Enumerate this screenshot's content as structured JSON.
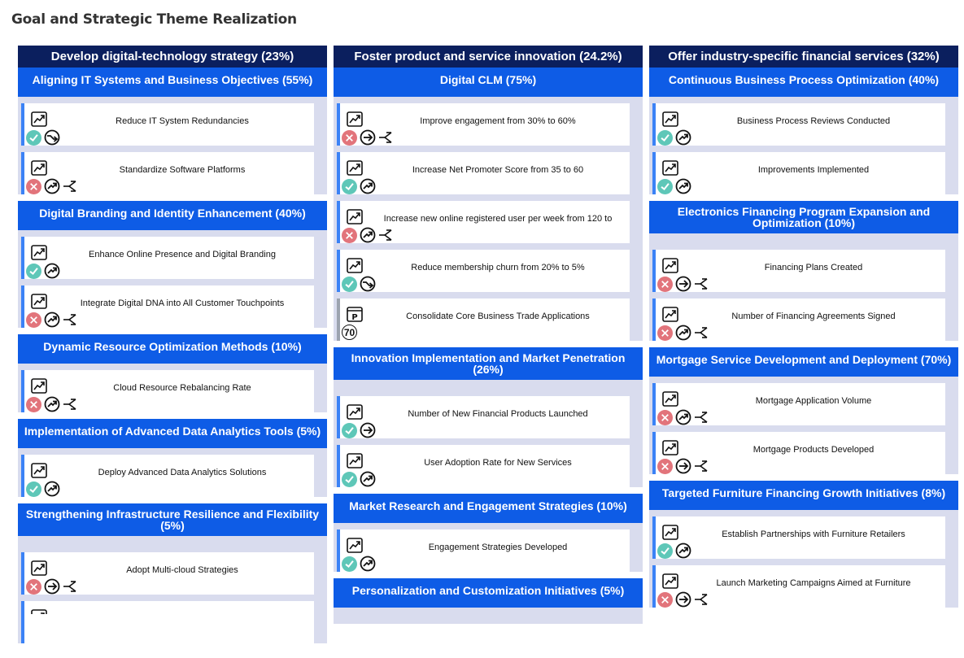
{
  "page": {
    "title": "Goal and Strategic Theme Realization"
  },
  "columns": [
    {
      "header": "Develop digital-technology strategy (23%)",
      "themes": [
        {
          "title": "Aligning IT Systems and Business Objectives (55%)",
          "cards": [
            {
              "title": "Reduce IT System Redundancies",
              "status": "ok",
              "trend": "wave",
              "fork": false
            },
            {
              "title": "Standardize Software Platforms",
              "status": "bad",
              "trend": "up",
              "fork": true
            }
          ]
        },
        {
          "title": "Digital Branding and Identity Enhancement (40%)",
          "cards": [
            {
              "title": "Enhance Online Presence and Digital Branding",
              "status": "ok",
              "trend": "up",
              "fork": false
            },
            {
              "title": "Integrate Digital DNA into All Customer Touchpoints",
              "status": "bad",
              "trend": "up",
              "fork": true
            }
          ]
        },
        {
          "title": "Dynamic Resource Optimization Methods (10%)",
          "cards": [
            {
              "title": "Cloud Resource Rebalancing Rate",
              "status": "bad",
              "trend": "up",
              "fork": true
            }
          ]
        },
        {
          "title": "Implementation of Advanced Data Analytics Tools (5%)",
          "cards": [
            {
              "title": "Deploy Advanced Data Analytics Solutions",
              "status": "ok",
              "trend": "up",
              "fork": false
            }
          ]
        },
        {
          "title": "Strengthening Infrastructure Resilience and Flexibility (5%)",
          "tall": true,
          "cards": [
            {
              "title": "Adopt Multi-cloud Strategies",
              "status": "bad",
              "trend": "right",
              "fork": true
            },
            {
              "title": "",
              "status": "none",
              "trend": "none",
              "fork": false
            }
          ]
        }
      ]
    },
    {
      "header": "Foster product and service innovation (24.2%)",
      "themes": [
        {
          "title": "Digital CLM (75%)",
          "cards": [
            {
              "title": "Improve engagement from 30% to 60%",
              "status": "bad",
              "trend": "right",
              "fork": true
            },
            {
              "title": "Increase Net Promoter Score from 35 to 60",
              "status": "ok",
              "trend": "up",
              "fork": false
            },
            {
              "title": "Increase new online registered user per week from 120 to",
              "status": "bad",
              "trend": "up",
              "fork": true
            },
            {
              "title": "Reduce membership churn from 20% to 5%",
              "status": "ok",
              "trend": "wave",
              "fork": false
            },
            {
              "title": "Consolidate Core Business Trade Applications",
              "status": "num",
              "num": "70",
              "trend": "none",
              "fork": false,
              "grey": true,
              "icon": "p"
            }
          ]
        },
        {
          "title": "Innovation Implementation and Market Penetration (26%)",
          "tall": true,
          "cards": [
            {
              "title": "Number of New Financial Products Launched",
              "status": "ok",
              "trend": "right",
              "fork": false
            },
            {
              "title": "User Adoption Rate for New Services",
              "status": "ok",
              "trend": "up",
              "fork": false
            }
          ]
        },
        {
          "title": "Market Research and Engagement Strategies (10%)",
          "cards": [
            {
              "title": "Engagement Strategies Developed",
              "status": "ok",
              "trend": "up",
              "fork": false
            }
          ]
        },
        {
          "title": "Personalization and Customization Initiatives (5%)",
          "cards": []
        }
      ]
    },
    {
      "header": "Offer industry-specific  financial services (32%)",
      "themes": [
        {
          "title": "Continuous Business Process Optimization (40%)",
          "cards": [
            {
              "title": "Business Process Reviews Conducted",
              "status": "ok",
              "trend": "up",
              "fork": false
            },
            {
              "title": "Improvements Implemented",
              "status": "ok",
              "trend": "up",
              "fork": false
            }
          ]
        },
        {
          "title": "Electronics Financing Program Expansion and Optimization (10%)",
          "tall": true,
          "cards": [
            {
              "title": "Financing Plans Created",
              "status": "bad",
              "trend": "right",
              "fork": true
            },
            {
              "title": "Number of Financing Agreements Signed",
              "status": "bad",
              "trend": "up",
              "fork": true
            }
          ]
        },
        {
          "title": "Mortgage Service Development and Deployment (70%)",
          "cards": [
            {
              "title": "Mortgage Application Volume",
              "status": "bad",
              "trend": "up",
              "fork": true
            },
            {
              "title": "Mortgage Products Developed",
              "status": "bad",
              "trend": "right",
              "fork": true
            }
          ]
        },
        {
          "title": "Targeted Furniture Financing Growth Initiatives (8%)",
          "cards": [
            {
              "title": "Establish Partnerships with Furniture Retailers",
              "status": "ok",
              "trend": "up",
              "fork": false
            },
            {
              "title": "Launch Marketing Campaigns Aimed at Furniture",
              "status": "bad",
              "trend": "right",
              "fork": true
            }
          ]
        }
      ]
    }
  ]
}
